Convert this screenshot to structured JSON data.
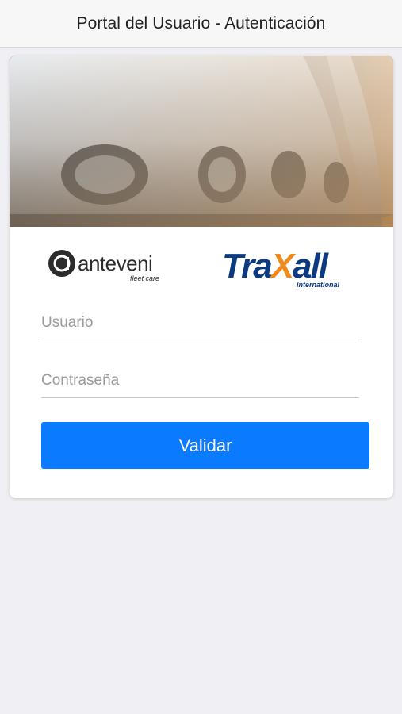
{
  "navbar": {
    "title": "Portal del Usuario - Autenticación"
  },
  "logos": {
    "anteveni": {
      "name": "anteveni",
      "tagline": "fleet care"
    },
    "traxall": {
      "name": "TraXall",
      "tagline": "international"
    }
  },
  "form": {
    "username": {
      "placeholder": "Usuario",
      "value": ""
    },
    "password": {
      "placeholder": "Contraseña",
      "value": ""
    },
    "submit_label": "Validar"
  },
  "colors": {
    "accent": "#0a7aff",
    "background": "#efeff4",
    "traxall_blue": "#0c3a80",
    "traxall_orange": "#f08a1c"
  }
}
